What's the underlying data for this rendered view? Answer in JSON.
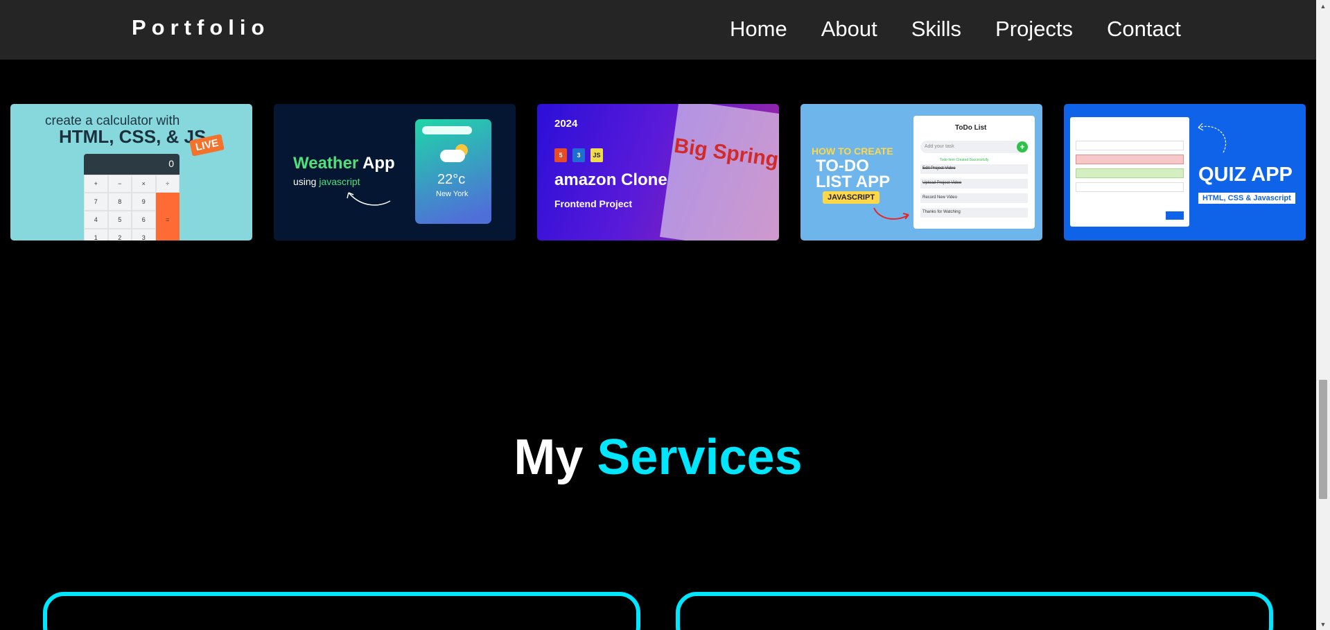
{
  "nav": {
    "logo": "Portfolio",
    "links": [
      "Home",
      "About",
      "Skills",
      "Projects",
      "Contact"
    ]
  },
  "projects": [
    {
      "name": "calculator",
      "line1": "create a calculator with",
      "line2": "HTML, CSS, & JS",
      "badge": "LIVE",
      "display": "0",
      "keys": [
        "+",
        "−",
        "×",
        "÷",
        "7",
        "8",
        "9",
        "",
        "4",
        "5",
        "6",
        "=",
        "1",
        "2",
        "3",
        ""
      ]
    },
    {
      "name": "weather",
      "title_a": "Weather",
      "title_b": " App",
      "sub_a": "using ",
      "sub_b": "javascript",
      "temp": "22°c",
      "city": "New York"
    },
    {
      "name": "amazon",
      "year": "2024",
      "badges": [
        "5",
        "3",
        "JS"
      ],
      "title": "amazon Clone",
      "subtitle": "Frontend Project",
      "promo": "Big Spring"
    },
    {
      "name": "todo",
      "head1": "HOW TO CREATE",
      "head2a": "TO-DO",
      "head2b": "LIST APP",
      "tag": "JAVASCRIPT",
      "app_title": "ToDo List",
      "placeholder": "Add your task",
      "toast": "Todo Item Created Successfully.",
      "rows": [
        "Edit Project Video",
        "Upload Project Video",
        "Record New Video",
        "Thanks for Watching"
      ]
    },
    {
      "name": "quiz",
      "title": "QUIZ APP",
      "subtitle": "HTML, CSS & Javascript"
    }
  ],
  "services": {
    "title_plain": "My ",
    "title_accent": "Services"
  },
  "colors": {
    "accent": "#00e6ff",
    "navbar": "#252525",
    "background": "#000000"
  },
  "icons": {
    "scroll_up": "scroll-up-arrow-icon",
    "scroll_down": "scroll-down-arrow-icon"
  }
}
